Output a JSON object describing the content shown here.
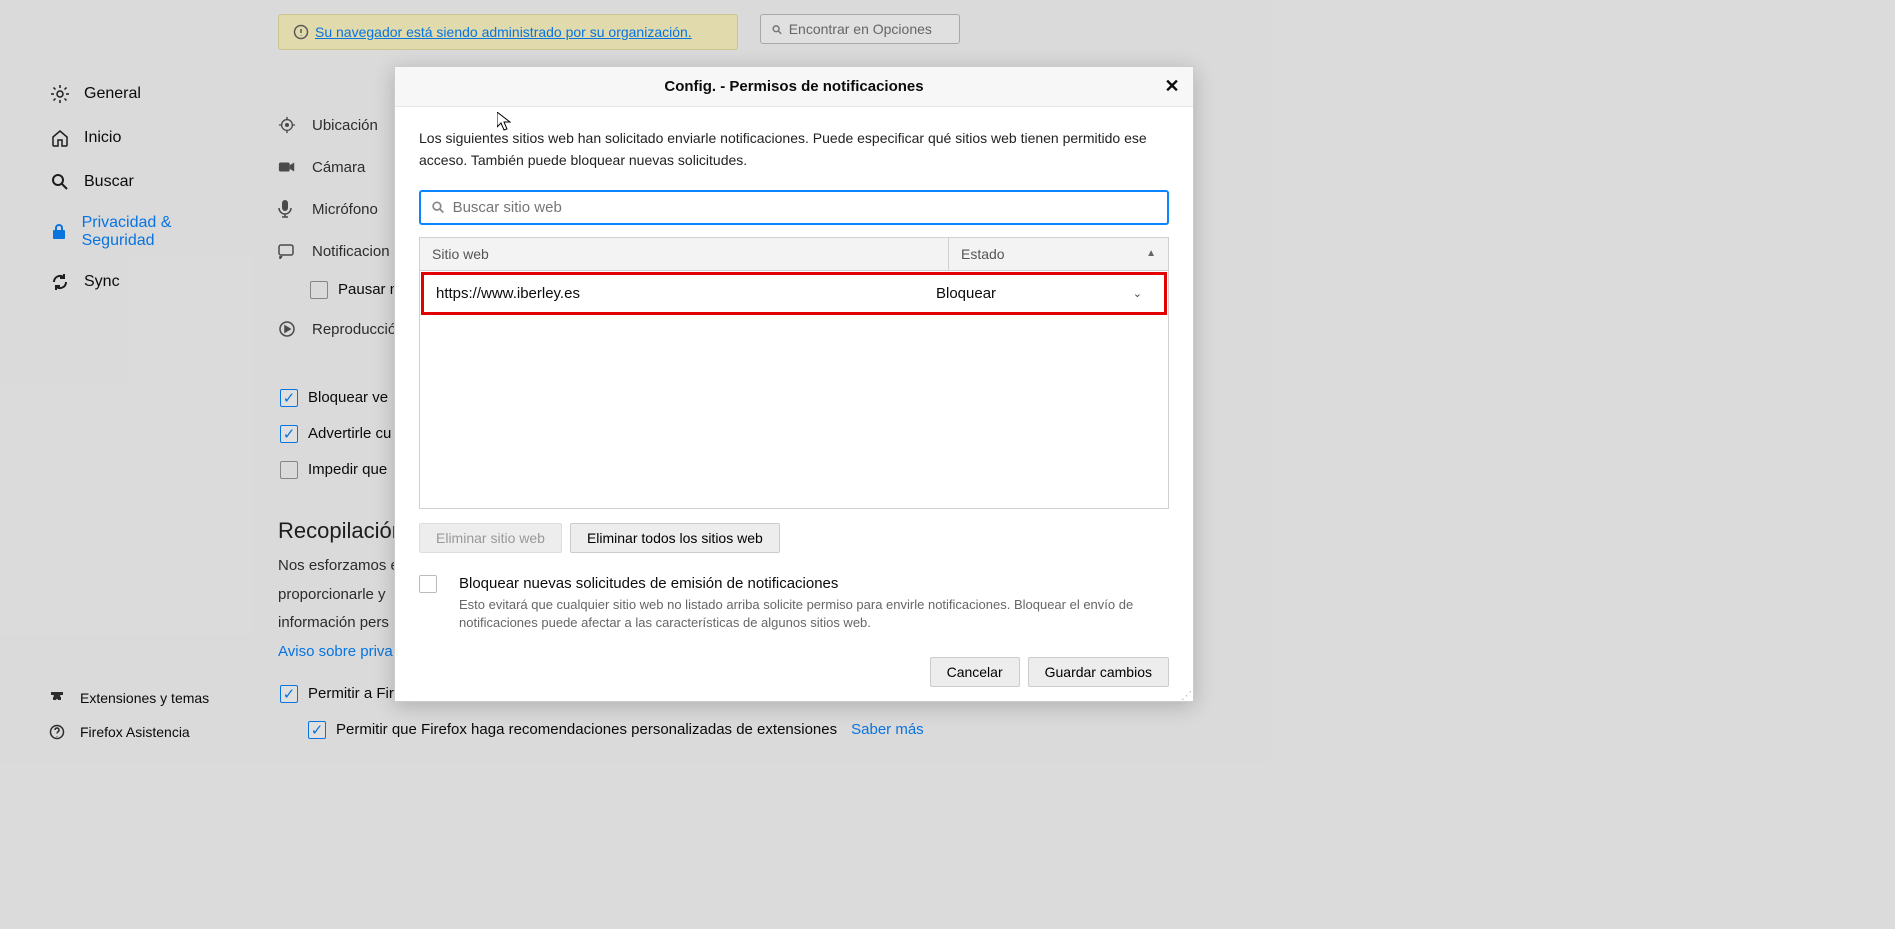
{
  "sidebar": {
    "items": [
      {
        "label": "General"
      },
      {
        "label": "Inicio"
      },
      {
        "label": "Buscar"
      },
      {
        "label": "Privacidad & Seguridad"
      },
      {
        "label": "Sync"
      }
    ],
    "bottom": [
      {
        "label": "Extensiones y temas"
      },
      {
        "label": "Firefox Asistencia"
      }
    ]
  },
  "banner": {
    "text": "Su navegador está siendo administrado por su organización."
  },
  "top_search": {
    "placeholder": "Encontrar en Opciones"
  },
  "permissions": {
    "items": [
      {
        "label": "Ubicación"
      },
      {
        "label": "Cámara"
      },
      {
        "label": "Micrófono"
      },
      {
        "label": "Notificacion"
      },
      {
        "label": "Reproducció"
      }
    ],
    "pause_label": "Pausar n",
    "block_popups": "Bloquear ve",
    "warn_addons": "Advertirle cu",
    "prevent_a11y": "Impedir que"
  },
  "collection": {
    "heading": "Recopilación",
    "p1": "Nos esforzamos e",
    "p2": "proporcionarle y",
    "p3": "información pers",
    "privacy_link": "Aviso sobre priva",
    "allow_tech": "Permitir a Firefox enviar datos técnicos y de interacción a Mozilla",
    "allow_rec": "Permitir que Firefox haga recomendaciones personalizadas de extensiones",
    "learn_more": "Saber más"
  },
  "modal": {
    "title": "Config. - Permisos de notificaciones",
    "description": "Los siguientes sitios web han solicitado enviarle notificaciones. Puede especificar qué sitios web tienen permitido ese acceso. También puede bloquear nuevas solicitudes.",
    "search_placeholder": "Buscar sitio web",
    "col_site": "Sitio web",
    "col_state": "Estado",
    "entries": [
      {
        "site": "https://www.iberley.es",
        "state": "Bloquear"
      }
    ],
    "remove_site": "Eliminar sitio web",
    "remove_all": "Eliminar todos los sitios web",
    "block_new_label": "Bloquear nuevas solicitudes de emisión de notificaciones",
    "block_new_sub": "Esto evitará que cualquier sitio web no listado arriba solicite permiso para envirle notificaciones. Bloquear el envío de notificaciones puede afectar a las características de algunos sitios web.",
    "cancel": "Cancelar",
    "save": "Guardar cambios"
  }
}
